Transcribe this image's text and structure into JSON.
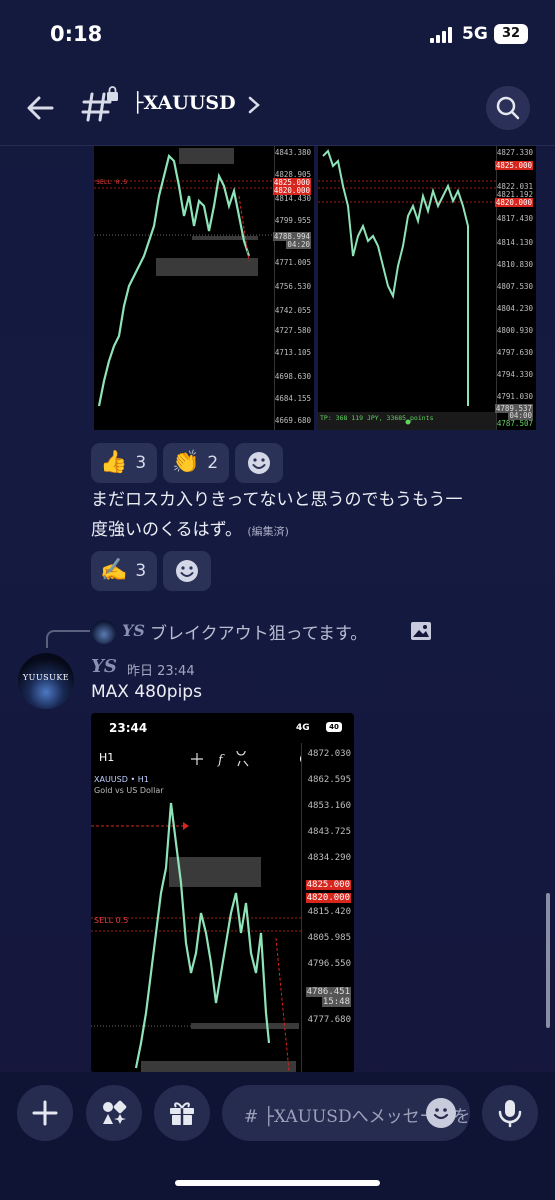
{
  "status": {
    "time": "0:18",
    "network": "5G",
    "battery": "32"
  },
  "header": {
    "channel_title": "├XAUUSD"
  },
  "images_top": {
    "left_ticks": [
      "4843.380",
      "4828.905",
      "4825.000",
      "4820.000",
      "4814.430",
      "4799.955",
      "4788.994",
      "04:20",
      "4771.005",
      "4756.530",
      "4742.055",
      "4727.580",
      "4713.105",
      "4698.630",
      "4684.155",
      "4669.680"
    ],
    "left_sell_label": "SELL 0.5",
    "right_ticks": [
      "4827.330",
      "4825.000",
      "4822.031",
      "4821.192",
      "4820.000",
      "4817.430",
      "4814.130",
      "4810.830",
      "4807.530",
      "4804.230",
      "4800.930",
      "4797.630",
      "4794.330",
      "4791.030",
      "4789.537",
      "04:00",
      "4787.507"
    ],
    "right_tp_label": "TP: 368 119 JPY, 33685 points"
  },
  "reactions1": [
    {
      "emoji": "👍",
      "count": "3"
    },
    {
      "emoji": "👏",
      "count": "2"
    }
  ],
  "message1": {
    "line1": "まだロスカ入りきってないと思うのでもうもう一",
    "line2": "度強いのくるはず。",
    "edited": "(編集済)"
  },
  "reactions2": [
    {
      "emoji": "✍️",
      "count": "3"
    }
  ],
  "reply": {
    "author": "YS",
    "text": "ブレイクアウト狙ってます。"
  },
  "message2": {
    "avatar_text": "YUUSUKE",
    "author": "YS",
    "timestamp": "昨日 23:44",
    "text": "MAX 480pips"
  },
  "screenshot": {
    "time": "23:44",
    "network": "4G",
    "battery": "40",
    "timeframe": "H1",
    "symbol": "XAUUSD • H1",
    "name": "Gold vs US Dollar",
    "sell_label": "SELL 0.5",
    "ticks": [
      "4872.030",
      "4862.595",
      "4853.160",
      "4843.725",
      "4834.290",
      "4825.000",
      "4820.000",
      "4815.420",
      "4805.985",
      "4796.550",
      "4786.451",
      "15:48",
      "4777.680"
    ]
  },
  "composer": {
    "placeholder": "# ├XAUUSDへメッセージを送信"
  },
  "colors": {
    "background": "#141a3e",
    "surface": "#2b3258",
    "accent_red": "#d7261e",
    "candle_green": "#8fe3b8"
  }
}
